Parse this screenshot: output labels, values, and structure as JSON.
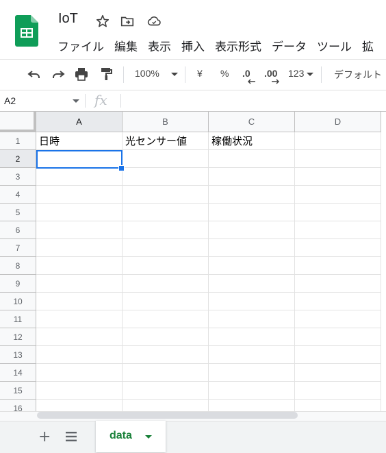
{
  "app": {
    "title": "IoT",
    "brand_color": "#0f9d58"
  },
  "menu": [
    "ファイル",
    "編集",
    "表示",
    "挿入",
    "表示形式",
    "データ",
    "ツール",
    "拡"
  ],
  "toolbar": {
    "zoom": "100%",
    "currency": "¥",
    "percent": "%",
    "decrease_decimal": ".0",
    "increase_decimal": ".00",
    "more_formats": "123",
    "font": "デフォルト"
  },
  "formula_bar": {
    "name_box": "A2",
    "fx": "fx"
  },
  "grid": {
    "columns": [
      "A",
      "B",
      "C",
      "D"
    ],
    "selected_column": "A",
    "selected_row": 2,
    "rows": [
      {
        "num": "1",
        "cells": [
          "日時",
          "光センサー値",
          "稼働状況",
          ""
        ]
      },
      {
        "num": "2",
        "cells": [
          "",
          "",
          "",
          ""
        ]
      },
      {
        "num": "3",
        "cells": [
          "",
          "",
          "",
          ""
        ]
      },
      {
        "num": "4",
        "cells": [
          "",
          "",
          "",
          ""
        ]
      },
      {
        "num": "5",
        "cells": [
          "",
          "",
          "",
          ""
        ]
      },
      {
        "num": "6",
        "cells": [
          "",
          "",
          "",
          ""
        ]
      },
      {
        "num": "7",
        "cells": [
          "",
          "",
          "",
          ""
        ]
      },
      {
        "num": "8",
        "cells": [
          "",
          "",
          "",
          ""
        ]
      },
      {
        "num": "9",
        "cells": [
          "",
          "",
          "",
          ""
        ]
      },
      {
        "num": "10",
        "cells": [
          "",
          "",
          "",
          ""
        ]
      },
      {
        "num": "11",
        "cells": [
          "",
          "",
          "",
          ""
        ]
      },
      {
        "num": "12",
        "cells": [
          "",
          "",
          "",
          ""
        ]
      },
      {
        "num": "13",
        "cells": [
          "",
          "",
          "",
          ""
        ]
      },
      {
        "num": "14",
        "cells": [
          "",
          "",
          "",
          ""
        ]
      },
      {
        "num": "15",
        "cells": [
          "",
          "",
          "",
          ""
        ]
      },
      {
        "num": "16",
        "cells": [
          "",
          "",
          "",
          ""
        ]
      }
    ]
  },
  "sheets": {
    "add": "+",
    "active_tab": "data"
  },
  "colors": {
    "selection": "#1a73e8",
    "sheet_tab": "#188038"
  }
}
